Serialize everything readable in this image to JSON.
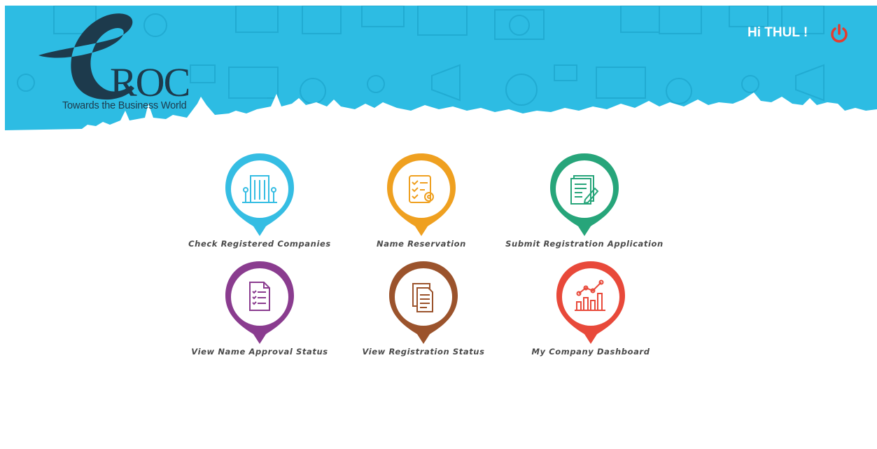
{
  "brand": {
    "logo_letter": "e",
    "logo_name": "ROC",
    "tagline": "Towards the Business World"
  },
  "header": {
    "greeting": "Hi THUL !",
    "power_icon": "power-icon"
  },
  "colors": {
    "banner": "#2dbce3",
    "blue": "#35bde3",
    "orange": "#efa020",
    "green": "#27a57a",
    "purple": "#8a3c8f",
    "brown": "#9b532c",
    "red": "#e8493a"
  },
  "menu": {
    "items": [
      {
        "label": "Check Registered Companies",
        "icon": "building-icon",
        "color": "blue"
      },
      {
        "label": "Name Reservation",
        "icon": "checklist-gear-icon",
        "color": "orange"
      },
      {
        "label": "Submit Registration Application",
        "icon": "document-pen-icon",
        "color": "green"
      },
      {
        "label": "View Name Approval Status",
        "icon": "checklist-document-icon",
        "color": "purple"
      },
      {
        "label": "View Registration Status",
        "icon": "documents-icon",
        "color": "brown"
      },
      {
        "label": "My Company Dashboard",
        "icon": "chart-icon",
        "color": "red"
      }
    ]
  }
}
